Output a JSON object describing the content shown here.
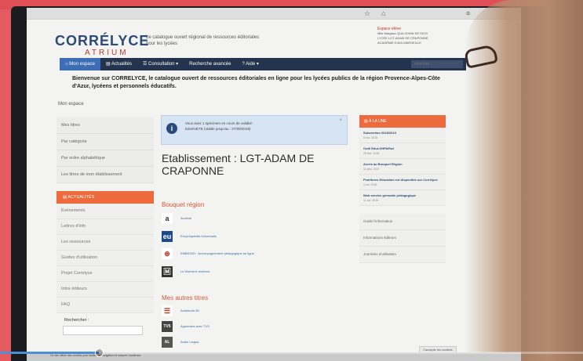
{
  "header": {
    "logo_main": "CORRÉLYCE",
    "logo_sub": "ATRIUM",
    "tagline": "Le catalogue ouvert régional de ressources éditoriales pour les lycées",
    "user_space_label": "Espace élève",
    "user_name": "Mlle Margaux QUILICHINI DE DIOS",
    "user_line2": "LYCÉE LGT-ADAM DE CRAPONNE",
    "user_line3": "ACADÉMIE D'AIX-MARSEILLE"
  },
  "nav": {
    "items": [
      {
        "label": "⌂ Mon espace",
        "active": true
      },
      {
        "label": "▤ Actualités",
        "active": false
      },
      {
        "label": "☰ Consultation ▾",
        "active": false
      },
      {
        "label": "Recherche avancée",
        "active": false
      },
      {
        "label": "? Aide ▾",
        "active": false
      }
    ],
    "search_placeholder": "chercher ..."
  },
  "welcome": "Bienvenue sur CORRELYCE, le catalogue ouvert de ressources éditoriales en ligne pour les lycées publics de la région Provence-Alpes-Côte d'Azur, lycéens et personnels éducatifs.",
  "breadcrumb": "Mon espace",
  "left_menu": [
    "Mes titres",
    "Par catégorie",
    "Par ordre alphabétique",
    "Les titres de mon établissement"
  ],
  "actualites": {
    "heading": "▤ ACTUALITÉS",
    "items": [
      "Événements",
      "Lettres d'info",
      "Les ressources",
      "Guides d'utilisation",
      "Projet Correlyce",
      "Infos éditeurs",
      "FAQ"
    ],
    "search_label": "Rechercher :"
  },
  "info_box": {
    "line1": "Vous avez 1 spécimen en cours de validité :",
    "line2": "EduSVETE (Valide jusqu'au : 27/09/2019)"
  },
  "etablissement_title": "Etablissement : LGT-ADAM DE CRAPONNE",
  "bouquet": {
    "title": "Bouquet région",
    "items": [
      {
        "label": "Acrobat",
        "logo": "a"
      },
      {
        "label": "Encyclopædia Universalis",
        "logo": "eu"
      },
      {
        "label": "EMBIGNO · Accompagnement pédagogique en ligne",
        "logo": "⊛"
      },
      {
        "label": "Le Monde.fr archives",
        "logo": "🄼"
      }
    ]
  },
  "autres_titres": {
    "title": "Mes autres titres",
    "items": [
      {
        "label": "Acadomia 3D"
      },
      {
        "label": "Apprendre avec TV5"
      },
      {
        "label": "Audio Lingua"
      }
    ]
  },
  "right": {
    "heading": "▤ À LA UNE",
    "news": [
      {
        "title": "Subvention 2018/2019",
        "date": "5 nov. 2018"
      },
      {
        "title": "Outil EduLOHPAPad",
        "date": "28 févr. 2018"
      },
      {
        "title": "Accès au Bouquet Région",
        "date": "11 janv. 2017"
      },
      {
        "title": "Pearltrees Education est disponible sur Corrélyce",
        "date": "3 oct. 2016"
      },
      {
        "title": "Web service grenoble pédagogique",
        "date": "11 oct. 2016"
      }
    ],
    "links": [
      "Guide l'information",
      "Informations éditeurs",
      "Journées d'utilisation"
    ]
  },
  "footer": {
    "taskbar_text": "Ce site utilise des cookies pour faciliter la navigation et mesurer l'audience.",
    "cookie_button": "J'accepte les cookies",
    "video_progress": 0.17
  }
}
